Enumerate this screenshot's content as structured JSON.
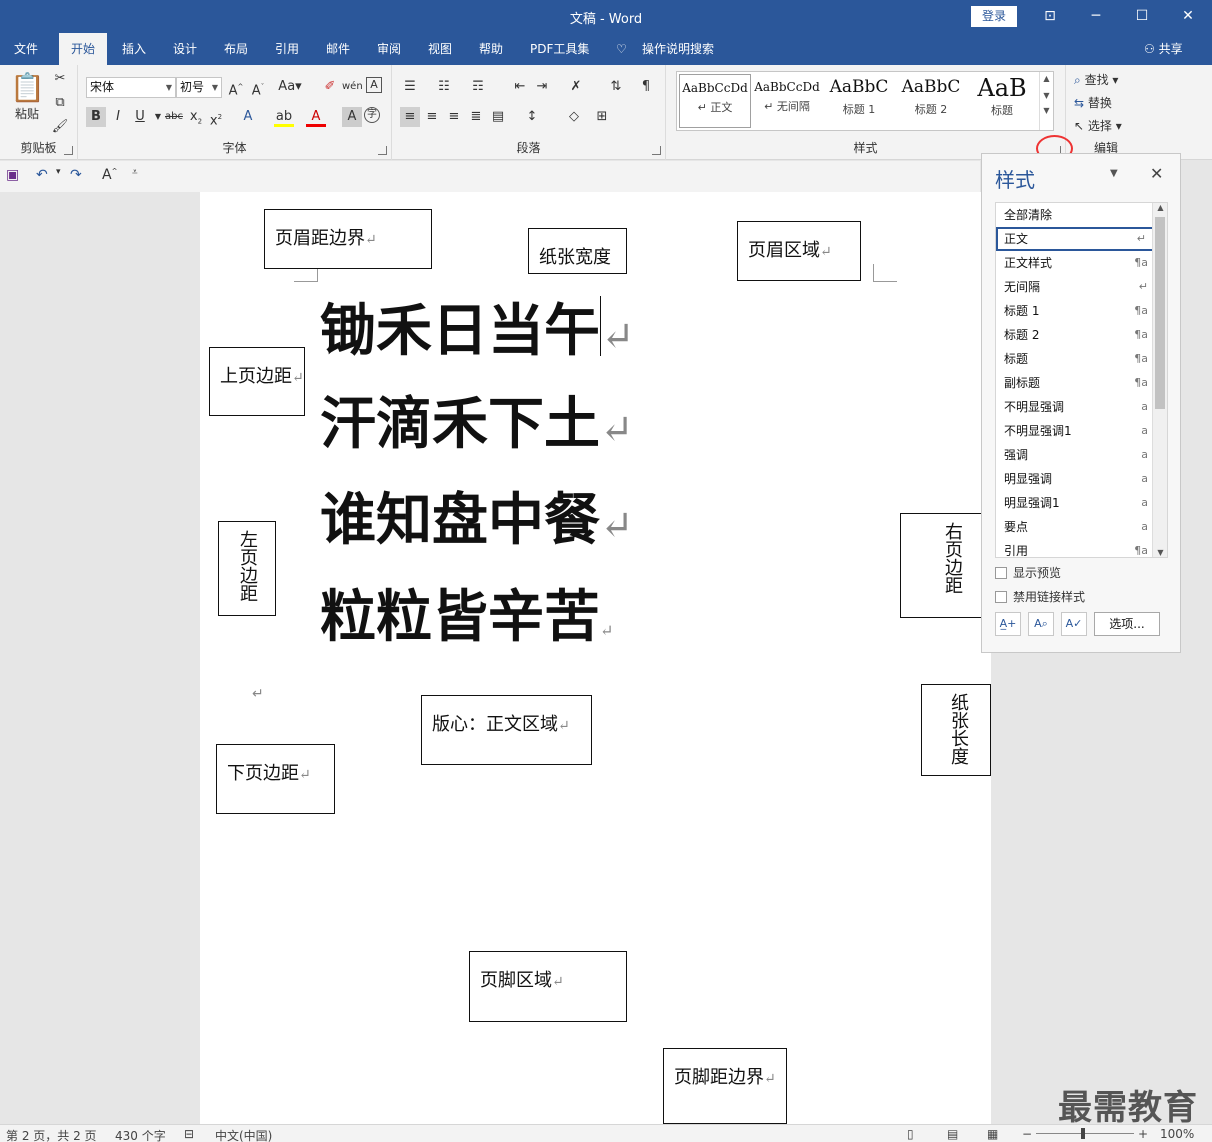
{
  "window": {
    "title": "文稿  -  Word",
    "login": "登录"
  },
  "tabs": [
    "文件",
    "开始",
    "插入",
    "设计",
    "布局",
    "引用",
    "邮件",
    "审阅",
    "视图",
    "帮助",
    "PDF工具集"
  ],
  "tell_me": "操作说明搜索",
  "share": "共享",
  "ribbon": {
    "clipboard": {
      "label": "剪贴板",
      "paste": "粘贴"
    },
    "font": {
      "label": "字体",
      "font_name": "宋体",
      "font_size": "初号"
    },
    "paragraph": {
      "label": "段落"
    },
    "styles": {
      "label": "样式",
      "gallery": [
        {
          "preview": "AaBbCcDd",
          "name": "正文"
        },
        {
          "preview": "AaBbCcDd",
          "name": "无间隔"
        },
        {
          "preview": "AaBbC",
          "name": "标题 1"
        },
        {
          "preview": "AaBbC",
          "name": "标题 2"
        },
        {
          "preview": "AaB",
          "name": "标题"
        }
      ]
    },
    "editing": {
      "label": "编辑",
      "find": "查找",
      "replace": "替换",
      "select": "选择"
    }
  },
  "document": {
    "poem": [
      "锄禾日当午",
      "汗滴禾下土",
      "谁知盘中餐",
      "粒粒皆辛苦"
    ],
    "boxes": {
      "header_margin": "页眉距边界",
      "paper_width": "纸张宽度",
      "header_area": "页眉区域",
      "top_margin": "上页边距",
      "left_margin": "左页边距",
      "right_margin": "右页边距",
      "body_area": "版心：正文区域",
      "bottom_margin": "下页边距",
      "paper_length": "纸张长度",
      "footer_area": "页脚区域",
      "footer_margin": "页脚距边界"
    },
    "para_mark": "↵"
  },
  "styles_pane": {
    "title": "样式",
    "items": [
      {
        "name": "全部清除",
        "sym": ""
      },
      {
        "name": "正文",
        "sym": "↵"
      },
      {
        "name": "正文样式",
        "sym": "¶a"
      },
      {
        "name": "无间隔",
        "sym": "↵"
      },
      {
        "name": "标题 1",
        "sym": "¶a"
      },
      {
        "name": "标题 2",
        "sym": "¶a"
      },
      {
        "name": "标题",
        "sym": "¶a"
      },
      {
        "name": "副标题",
        "sym": "¶a"
      },
      {
        "name": "不明显强调",
        "sym": "a"
      },
      {
        "name": "不明显强调1",
        "sym": "a"
      },
      {
        "name": "强调",
        "sym": "a"
      },
      {
        "name": "明显强调",
        "sym": "a"
      },
      {
        "name": "明显强调1",
        "sym": "a"
      },
      {
        "name": "要点",
        "sym": "a"
      },
      {
        "name": "引用",
        "sym": "¶a"
      }
    ],
    "show_preview": "显示预览",
    "disable_linked": "禁用链接样式",
    "options": "选项..."
  },
  "status": {
    "page": "第 2 页，共 2 页",
    "words": "430 个字",
    "lang": "中文(中国)",
    "zoom": "100%"
  },
  "watermark": "最需教育"
}
